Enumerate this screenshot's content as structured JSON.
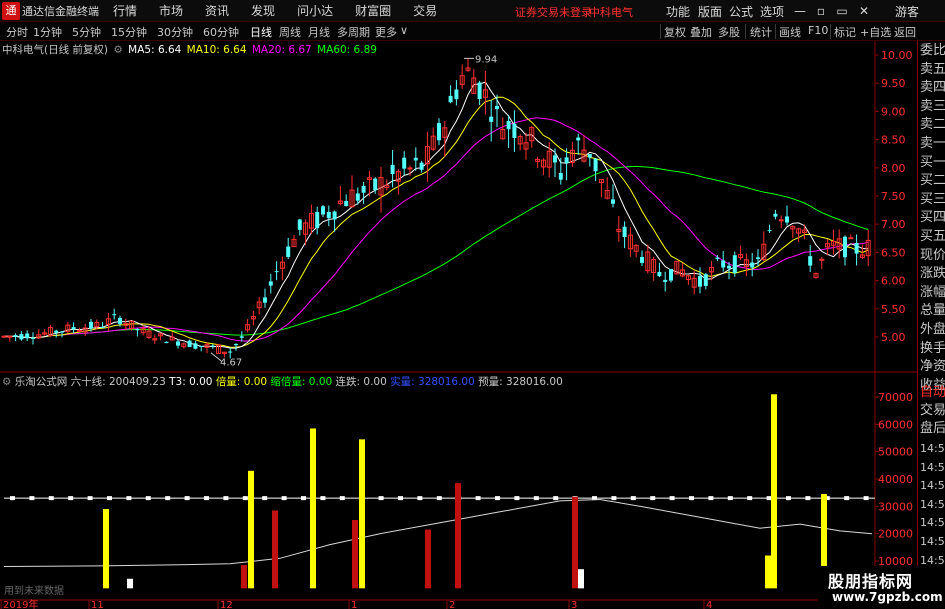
{
  "titlebar": {
    "app_name": "通达信金融终端",
    "logo_glyph": "通",
    "menus": [
      "行情",
      "市场",
      "资讯",
      "发现",
      "问小达",
      "财富圈",
      "交易"
    ],
    "warning": "证券交易未登录",
    "stock": "中科电气",
    "right_menus": [
      "功能",
      "版面",
      "公式",
      "选项"
    ],
    "user": "游客"
  },
  "toolbar": {
    "periods": [
      "分时",
      "1分钟",
      "5分钟",
      "15分钟",
      "30分钟",
      "60分钟",
      "日线",
      "周线",
      "月线",
      "多周期",
      "更多"
    ],
    "active_period": "日线",
    "right_buttons": [
      "复权",
      "叠加",
      "多股",
      "统计",
      "画线",
      "F10",
      "标记",
      "+自选",
      "返回"
    ]
  },
  "main_chart": {
    "label": "中科电气(日线 前复权)",
    "ma": [
      {
        "label": "MA5: 6.64",
        "color": "#ffffff"
      },
      {
        "label": "MA10: 6.64",
        "color": "#ffff00"
      },
      {
        "label": "MA20: 6.67",
        "color": "#ff00ff"
      },
      {
        "label": "MA60: 6.89",
        "color": "#00ff00"
      }
    ],
    "price_axis": [
      "10.00",
      "9.50",
      "9.00",
      "8.50",
      "8.00",
      "7.50",
      "7.00",
      "6.50",
      "6.00",
      "5.50",
      "5.00"
    ],
    "high_label": "9.94",
    "low_label": "4.67"
  },
  "indicator": {
    "name": "乐淘公式网",
    "line_label": "六十线: 200409.23",
    "t3": "T3: 0.00",
    "bei": "倍量: 0.00",
    "suo": "缩倍量: 0.00",
    "lian": "连跌: 0.00",
    "shi": "实量: 328016.00",
    "yu": "预量: 328016.00",
    "axis": [
      "70000",
      "60000",
      "50000",
      "40000",
      "30000",
      "20000",
      "10000"
    ],
    "future_label": "用到未来数据"
  },
  "date_axis": [
    "2019年",
    "11",
    "12",
    "1",
    "2",
    "3",
    "4"
  ],
  "right_panel": {
    "items": [
      "委比",
      "卖五",
      "卖四",
      "卖三",
      "卖二",
      "卖一",
      "买一",
      "买二",
      "买三",
      "买四",
      "买五",
      "现价",
      "涨跌",
      "涨幅",
      "总量",
      "外盘",
      "换手",
      "净资",
      "收益"
    ],
    "lower": [
      "自动",
      "交易",
      "盘后"
    ],
    "times": [
      "14:56",
      "14:56",
      "14:56",
      "14:56",
      "14:56",
      "14:56",
      "14:56",
      "14:56",
      "14:56"
    ]
  },
  "watermark": {
    "title": "股朋指标网",
    "url": "www.7gpzb.com"
  },
  "colors": {
    "up": "#ff3030",
    "down": "#54ffff",
    "ma5": "#ffffff",
    "ma10": "#ffff00",
    "ma20": "#ff00ff",
    "ma60": "#00ff00"
  }
}
